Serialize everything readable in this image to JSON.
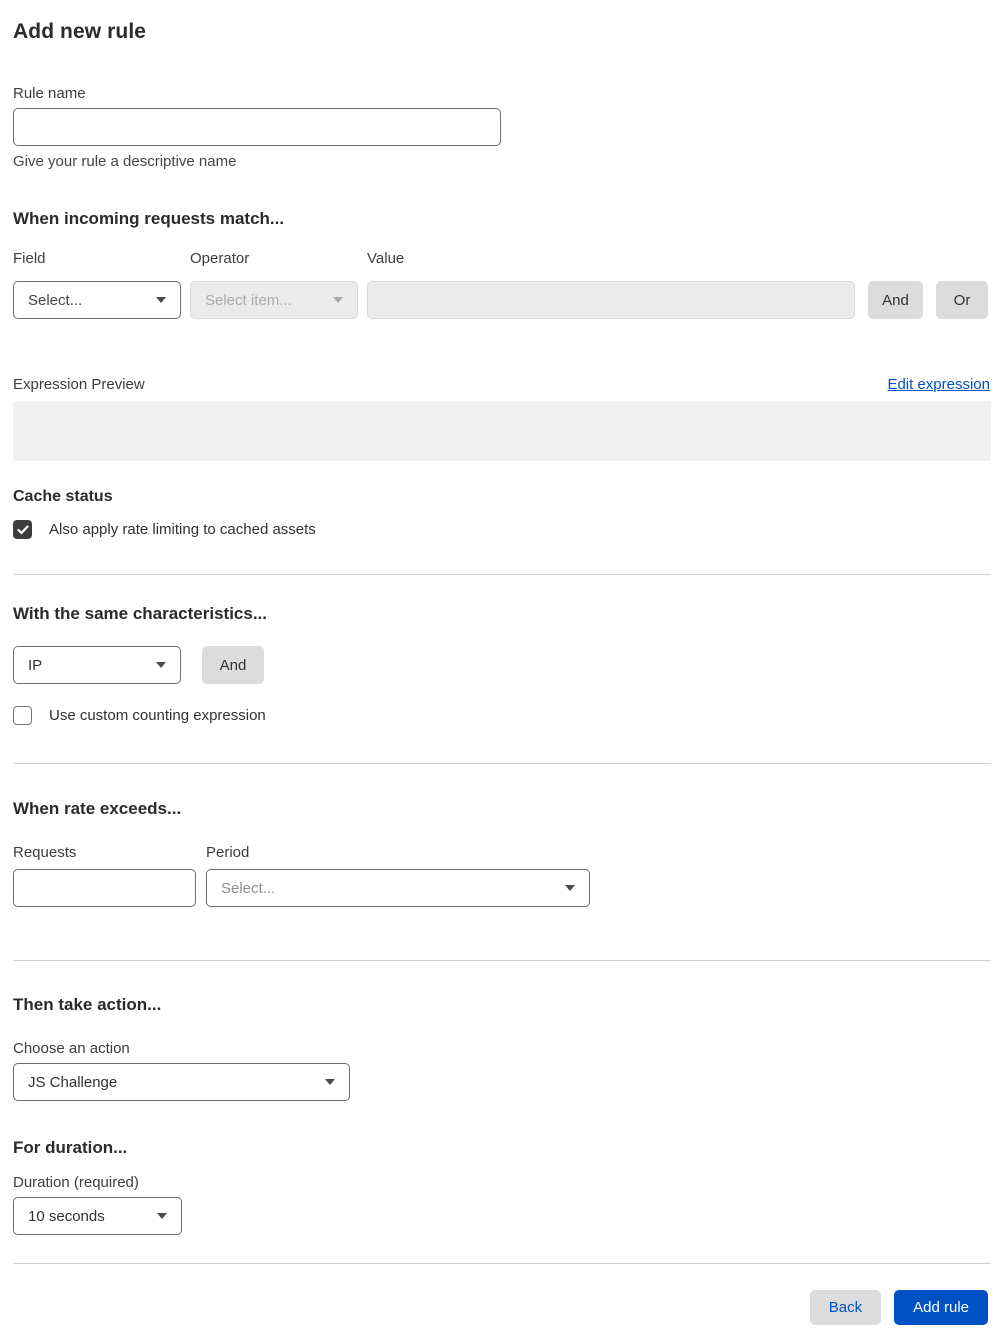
{
  "page": {
    "title": "Add new rule"
  },
  "rule_name": {
    "label": "Rule name",
    "value": "",
    "helper": "Give your rule a descriptive name"
  },
  "match": {
    "heading": "When incoming requests match...",
    "field": {
      "label": "Field",
      "selected": "Select..."
    },
    "operator": {
      "label": "Operator",
      "selected": "Select item..."
    },
    "value": {
      "label": "Value",
      "value": ""
    },
    "and_label": "And",
    "or_label": "Or",
    "expression_preview_label": "Expression Preview",
    "edit_expression_label": "Edit expression",
    "preview_content": ""
  },
  "cache": {
    "heading": "Cache status",
    "checkbox_label": "Also apply rate limiting to cached assets",
    "checked": true
  },
  "characteristics": {
    "heading": "With the same characteristics...",
    "selected": "IP",
    "and_label": "And",
    "checkbox_label": "Use custom counting expression",
    "checked": false
  },
  "rate": {
    "heading": "When rate exceeds...",
    "requests": {
      "label": "Requests",
      "value": ""
    },
    "period": {
      "label": "Period",
      "selected": "Select..."
    }
  },
  "action": {
    "heading": "Then take action...",
    "label": "Choose an action",
    "selected": "JS Challenge"
  },
  "duration": {
    "heading": "For duration...",
    "label": "Duration (required)",
    "selected": "10 seconds"
  },
  "footer": {
    "back_label": "Back",
    "submit_label": "Add rule"
  },
  "colors": {
    "accent_blue": "#0051c3",
    "button_gray": "#dcdcdc",
    "disabled_bg": "#ebebeb",
    "checkbox_dark": "#3d3d3d",
    "preview_bg": "#f1f1f1"
  }
}
